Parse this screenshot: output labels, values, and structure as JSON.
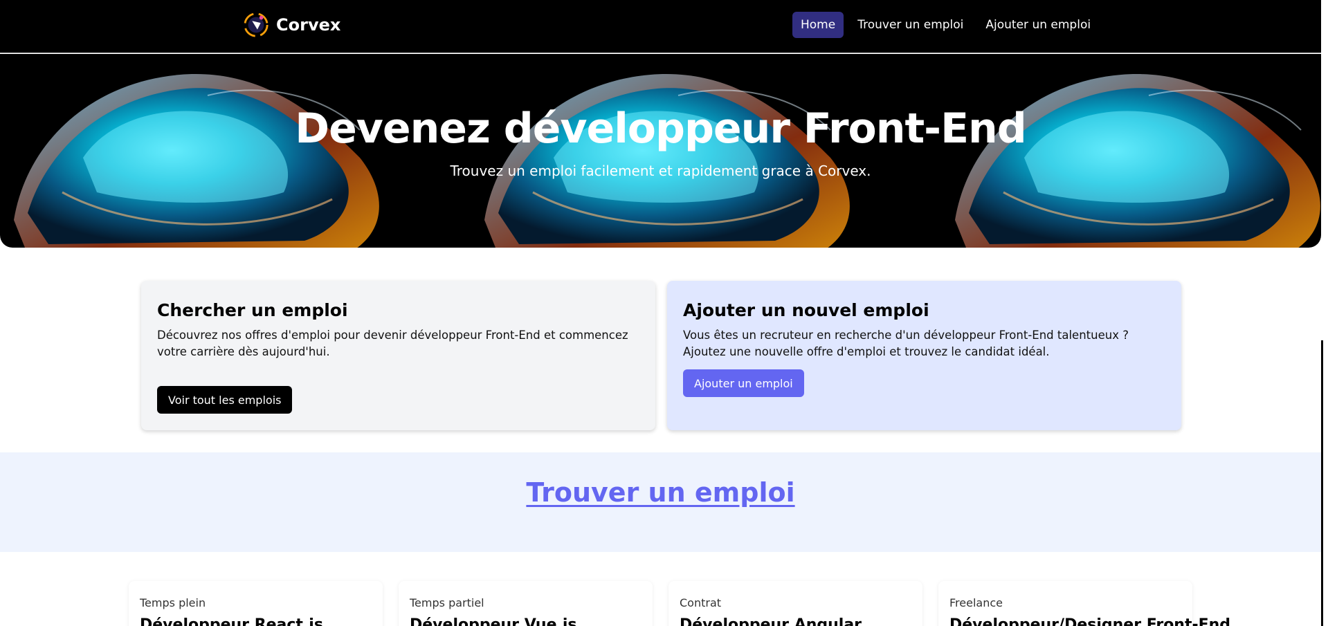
{
  "brand": {
    "name": "Corvex",
    "logo_icon": "corvex-logo-icon"
  },
  "nav": {
    "items": [
      {
        "label": "Home",
        "active": true
      },
      {
        "label": "Trouver un emploi",
        "active": false
      },
      {
        "label": "Ajouter un emploi",
        "active": false
      }
    ]
  },
  "hero": {
    "title": "Devenez développeur Front-End",
    "subtitle": "Trouvez un emploi facilement et rapidement grace à Corvex."
  },
  "cards": {
    "search": {
      "title": "Chercher un emploi",
      "text": "Découvrez nos offres d'emploi pour devenir développeur Front-End et commencez votre carrière dès aujourd'hui.",
      "button": "Voir tout les emplois"
    },
    "add": {
      "title": "Ajouter un nouvel emploi",
      "text": "Vous êtes un recruteur en recherche d'un développeur Front-End talentueux ? Ajoutez une nouvelle offre d'emploi et trouvez le candidat idéal.",
      "button": "Ajouter un emploi"
    }
  },
  "section": {
    "title": "Trouver un emploi"
  },
  "jobs": [
    {
      "type": "Temps plein",
      "title": "Développeur React.js"
    },
    {
      "type": "Temps partiel",
      "title": "Développeur Vue.js"
    },
    {
      "type": "Contrat",
      "title": "Développeur Angular"
    },
    {
      "type": "Freelance",
      "title": "Développeur/Designer Front-End"
    }
  ],
  "colors": {
    "nav_active": "#312e81",
    "accent": "#6366f1",
    "card_add_bg": "#e0e7ff",
    "section_bg": "#eef3fe"
  }
}
